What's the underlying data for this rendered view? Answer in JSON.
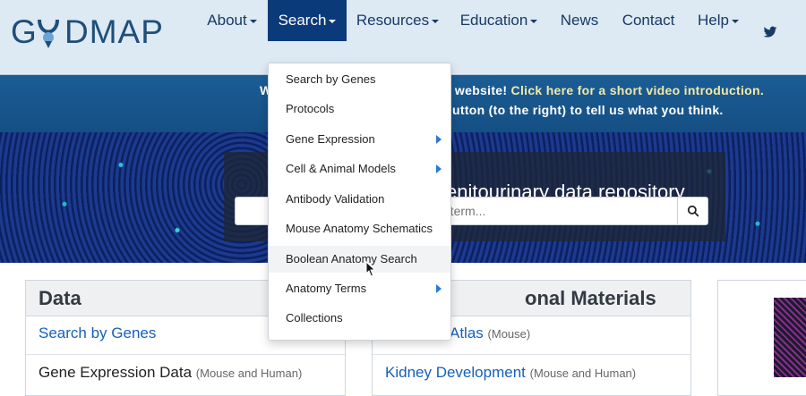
{
  "logo": {
    "text": "GUDMAP"
  },
  "nav": {
    "items": [
      {
        "label": "About",
        "has_caret": true
      },
      {
        "label": "Search",
        "has_caret": true,
        "active": true
      },
      {
        "label": "Resources",
        "has_caret": true
      },
      {
        "label": "Education",
        "has_caret": true
      },
      {
        "label": "News",
        "has_caret": false
      },
      {
        "label": "Contact",
        "has_caret": false
      },
      {
        "label": "Help",
        "has_caret": true
      }
    ],
    "twitter_icon": "twitter-icon"
  },
  "banner": {
    "line1_prefix": "W",
    "line1_mid": "website!",
    "line1_link": "Click here for a short video introduction.",
    "line2": "utton (to the right) to tell us what you think."
  },
  "hero": {
    "title": "enitourinary data repository",
    "search_placeholder": "h term...",
    "search_icon": "search-icon"
  },
  "dropdown": {
    "items": [
      {
        "label": "Search by Genes",
        "submenu": false
      },
      {
        "label": "Protocols",
        "submenu": false
      },
      {
        "label": "Gene Expression",
        "submenu": true
      },
      {
        "label": "Cell & Animal Models",
        "submenu": true
      },
      {
        "label": "Antibody Validation",
        "submenu": false
      },
      {
        "label": "Mouse Anatomy Schematics",
        "submenu": false
      },
      {
        "label": "Boolean Anatomy Search",
        "submenu": false,
        "hovered": true
      },
      {
        "label": "Anatomy Terms",
        "submenu": true
      },
      {
        "label": "Collections",
        "submenu": false
      }
    ]
  },
  "panels": {
    "data": {
      "title": "Data",
      "link": "Search by Genes",
      "row2_main": "Gene Expression Data",
      "row2_small": "(Mouse and Human)"
    },
    "materials": {
      "title": "onal Materials",
      "link1_main": "Atlas",
      "link1_small": "(Mouse)",
      "link2_main": "Kidney Development",
      "link2_small": "(Mouse and Human)"
    }
  },
  "colors": {
    "nav_bg": "#dde9f3",
    "active_bg": "#0a3a7a",
    "banner_bg": "#1b5d95",
    "link": "#1760b8",
    "banner_link": "#f2e9a6"
  }
}
